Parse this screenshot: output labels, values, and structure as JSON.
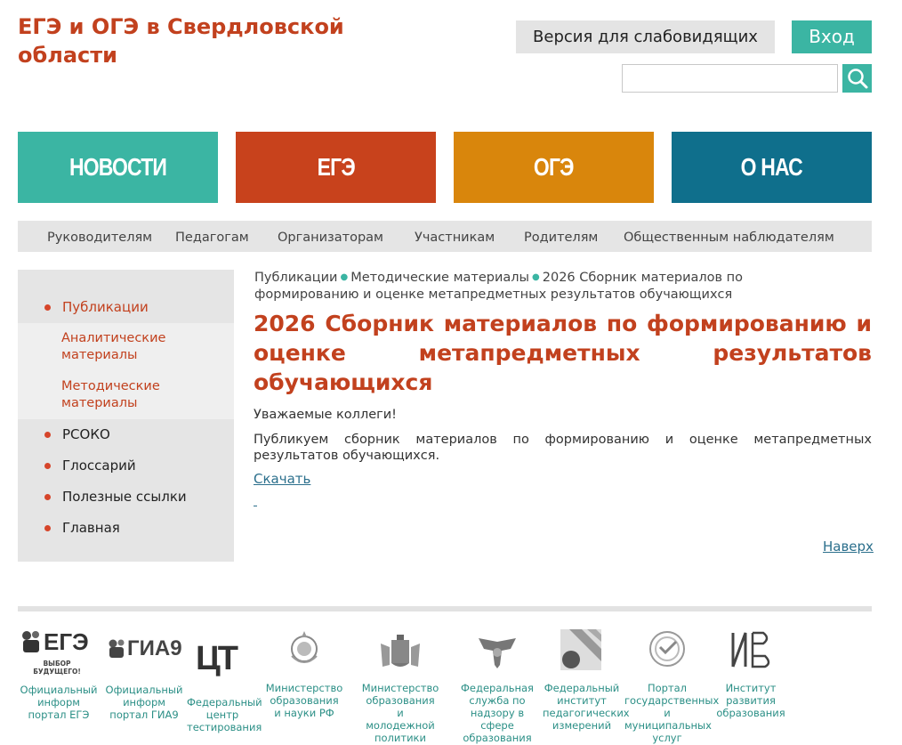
{
  "header": {
    "site_title": "ЕГЭ и ОГЭ в Свердловской области",
    "vision_button": "Версия для слабовидящих",
    "login_button": "Вход",
    "search_value": ""
  },
  "tiles": [
    {
      "label": "НОВОСТИ",
      "color": "#3bb5a3"
    },
    {
      "label": "ЕГЭ",
      "color": "#c8421c"
    },
    {
      "label": "ОГЭ",
      "color": "#d9860c"
    },
    {
      "label": "О НАС",
      "color": "#0f6f8c"
    }
  ],
  "audience": [
    "Руководителям",
    "Педагогам",
    "Организаторам",
    "Участникам",
    "Родителям",
    "Общественным наблюдателям"
  ],
  "sidebar": {
    "active": "Публикации",
    "sub": [
      "Аналитические материалы",
      "Методические материалы"
    ],
    "items": [
      "РСОКО",
      "Глоссарий",
      "Полезные ссылки",
      "Главная"
    ]
  },
  "breadcrumb": {
    "crumb1": "Публикации",
    "crumb2": "Методические материалы",
    "crumb3": "2026 Сборник материалов по формированию и оценке метапредметных результатов обучающихся"
  },
  "article": {
    "title": "2026 Сборник материалов по формированию и оценке метапредметных результатов обучающихся",
    "greeting": "Уважаемые коллеги!",
    "body": "Публикуем сборник материалов по формированию и оценке метапредметных результатов обучающихся.",
    "download": "Скачать",
    "to_top": "Наверх"
  },
  "partners": [
    {
      "logo": "ЕГЭ",
      "tagline": "ВЫБОР БУДУЩЕГО!",
      "caption": "Официальный информ портал ЕГЭ"
    },
    {
      "logo": "ГИА9",
      "caption": "Официальный информ портал ГИА9"
    },
    {
      "logo": "ЦТ",
      "caption": "Федеральный центр тестирования"
    },
    {
      "logo": "emblem-icon",
      "caption": "Министерство образования и науки РФ"
    },
    {
      "logo": "coat-of-arms-icon",
      "caption": "Министерство образования и молодежной политики Свердловской"
    },
    {
      "logo": "eagle-icon",
      "caption": "Федеральная служба по надзору в сфере образования"
    },
    {
      "logo": "stripes-icon",
      "caption": "Федеральный институт педагогических измерений"
    },
    {
      "logo": "gosuslugi-icon",
      "caption": "Портал государственных и муниципальных услуг"
    },
    {
      "logo": "ИРО",
      "caption": "Институт развития образования"
    }
  ]
}
